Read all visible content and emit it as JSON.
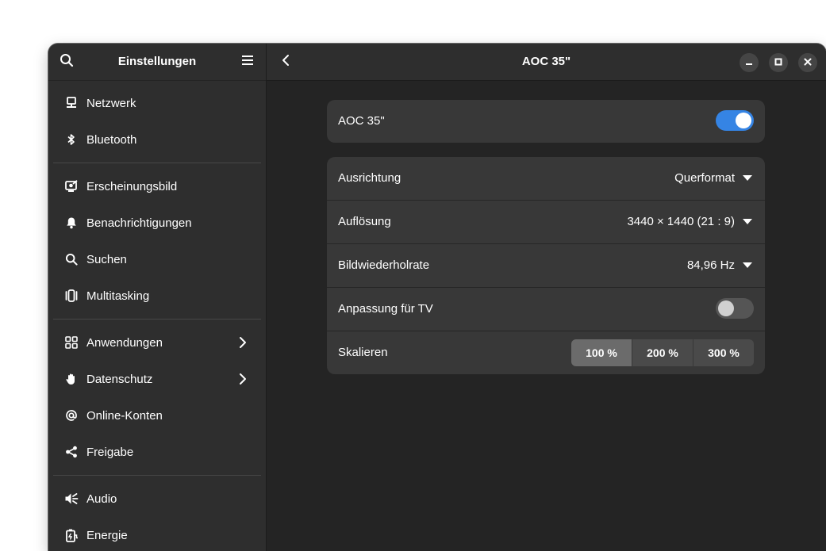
{
  "sidebar": {
    "title": "Einstellungen",
    "groups": [
      [
        {
          "icon": "network-icon",
          "label": "Netzwerk"
        },
        {
          "icon": "bluetooth-icon",
          "label": "Bluetooth"
        }
      ],
      [
        {
          "icon": "appearance-icon",
          "label": "Erscheinungsbild"
        },
        {
          "icon": "bell-icon",
          "label": "Benachrichtigungen"
        },
        {
          "icon": "search-icon",
          "label": "Suchen"
        },
        {
          "icon": "multitasking-icon",
          "label": "Multitasking"
        }
      ],
      [
        {
          "icon": "apps-grid-icon",
          "label": "Anwendungen",
          "chevron": true
        },
        {
          "icon": "hand-icon",
          "label": "Datenschutz",
          "chevron": true
        },
        {
          "icon": "at-icon",
          "label": "Online-Konten"
        },
        {
          "icon": "share-icon",
          "label": "Freigabe"
        }
      ],
      [
        {
          "icon": "speaker-icon",
          "label": "Audio"
        },
        {
          "icon": "battery-icon",
          "label": "Energie"
        }
      ]
    ]
  },
  "content": {
    "title": "AOC 35\"",
    "monitor_row": {
      "label": "AOC 35\"",
      "enabled": true
    },
    "settings": {
      "orientation": {
        "label": "Ausrichtung",
        "value": "Querformat"
      },
      "resolution": {
        "label": "Auflösung",
        "value": "3440 × 1440 (21 : 9)"
      },
      "refresh": {
        "label": "Bildwiederholrate",
        "value": "84,96 Hz"
      },
      "tv": {
        "label": "Anpassung für TV",
        "enabled": false
      },
      "scale": {
        "label": "Skalieren",
        "options": [
          "100 %",
          "200 %",
          "300 %"
        ],
        "selected": "100 %"
      }
    }
  },
  "colors": {
    "accent": "#3584e4",
    "window_bg": "#242424",
    "sidebar_bg": "#2e2e2e",
    "card_bg": "#383838"
  }
}
